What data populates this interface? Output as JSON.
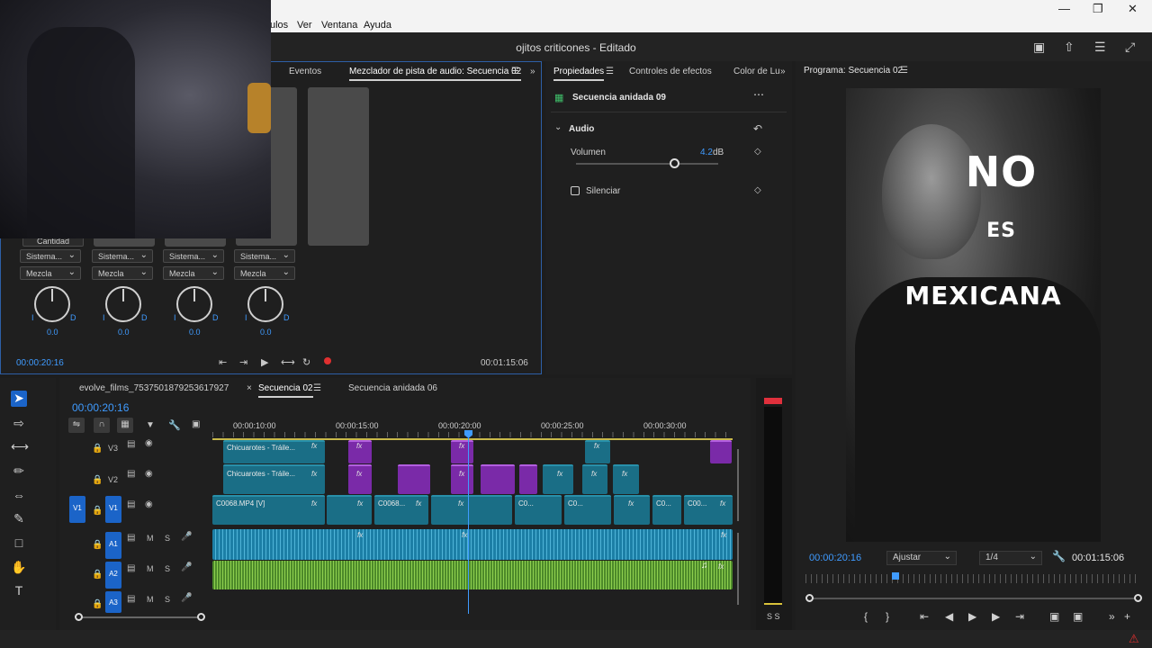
{
  "menu": {
    "items": [
      "ulos",
      "Ver",
      "Ventana",
      "Ayuda"
    ]
  },
  "window": {
    "title": "ojitos criticones - Editado"
  },
  "mixer_panel": {
    "tabs": [
      "Eventos",
      "Mezclador de pista de audio: Secuencia 02"
    ],
    "top_selector": "Cantidad",
    "strips": [
      {
        "input": "Sistema...",
        "mode": "Mezcla",
        "left": "I",
        "right": "D",
        "value": "0.0"
      },
      {
        "input": "Sistema...",
        "mode": "Mezcla",
        "left": "I",
        "right": "D",
        "value": "0.0"
      },
      {
        "input": "Sistema...",
        "mode": "Mezcla",
        "left": "I",
        "right": "D",
        "value": "0.0"
      },
      {
        "input": "Sistema...",
        "mode": "Mezcla",
        "left": "I",
        "right": "D",
        "value": "0.0"
      }
    ],
    "current_time": "00:00:20:16",
    "duration": "00:01:15:06"
  },
  "properties_panel": {
    "tabs": [
      "Propiedades",
      "Controles de efectos",
      "Color de Lu"
    ],
    "clip_name": "Secuencia anidada 09",
    "section": "Audio",
    "volume_label": "Volumen",
    "volume_value": "4.2",
    "volume_unit": "dB",
    "volume_level": 0.69,
    "mute_label": "Silenciar"
  },
  "program_monitor": {
    "tab": "Programa: Secuencia 02",
    "overlay_lines": [
      "NO",
      "ES",
      "MEXICANA"
    ],
    "current_time": "00:00:20:16",
    "fit": "Ajustar",
    "resolution": "1/4",
    "duration": "00:01:15:06"
  },
  "timeline": {
    "tabs": [
      "evolve_films_7537501879253617927",
      "Secuencia 02",
      "Secuencia anidada 06"
    ],
    "current_time": "00:00:20:16",
    "ruler": [
      "00:00:10:00",
      "00:00:15:00",
      "00:00:20:00",
      "00:00:25:00",
      "00:00:30:00"
    ],
    "tracks": {
      "v3": "V3",
      "v2": "V2",
      "v1_src": "V1",
      "v1": "V1",
      "a1": "A1",
      "a2": "A2",
      "a3": "A3",
      "m": "M",
      "s": "S"
    },
    "clips": {
      "v3_main": "Chicuarotes - Tráile...",
      "v2_main": "Chicuarotes - Tráile...",
      "v1_main": "C0068.MP4 [V]",
      "v1_b": "C0068...",
      "v1_c": "C0...",
      "v1_d": "C0...",
      "v1_e": "C0...",
      "v1_f": "C00..."
    },
    "fx": "fx"
  },
  "meter": {
    "labels": "S S"
  },
  "colors": {
    "accent": "#3f9bff",
    "video_clip": "#1a6e86",
    "nested_clip": "#7a2aa8",
    "audio_clip": "#1c7fa6",
    "audio_green": "#4d8a2a",
    "record": "#e03030"
  }
}
